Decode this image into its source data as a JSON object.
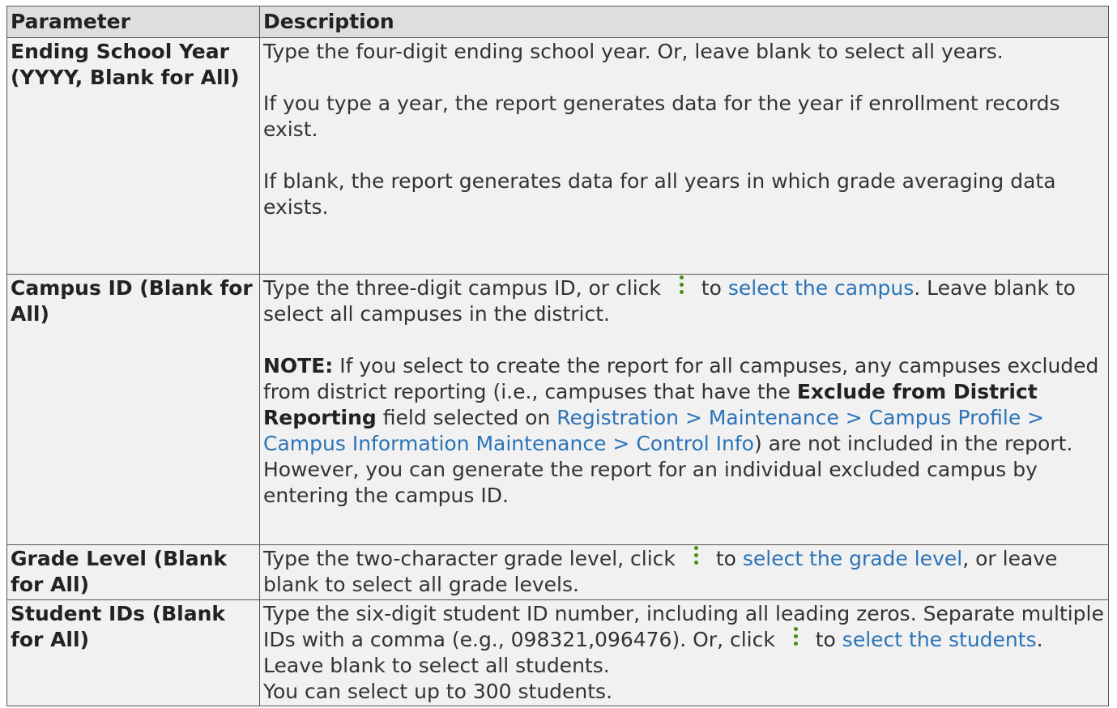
{
  "table": {
    "headers": {
      "parameter": "Parameter",
      "description": "Description"
    },
    "rows": [
      {
        "param": "Ending School Year (YYYY, Blank for All)",
        "p1": "Type the four-digit ending school year. Or, leave blank to select all years.",
        "p2": "If you type a year, the report generates data for the year if enrollment records exist.",
        "p3": "If blank, the report generates data for all years in which grade averaging data exists."
      },
      {
        "param": "Campus ID (Blank for All)",
        "text1": "Type the three-digit campus ID, or click",
        "text2": "to",
        "link1": "select the campus",
        "text3": ". Leave blank to select all campuses in the district.",
        "note_label": "NOTE:",
        "note_text1": " If you select to create the report for all campuses, any campuses excluded from district reporting (i.e., campuses that have the ",
        "note_bold": "Exclude from District Reporting",
        "note_text2": " field selected on ",
        "note_link": "Registration > Maintenance > Campus Profile > Campus Information Maintenance > Control Info",
        "note_text3": ") are not included in the report. However, you can generate the report for an individual excluded campus by entering the campus ID."
      },
      {
        "param": "Grade Level (Blank for All)",
        "text1": "Type the two-character grade level, click",
        "text2": "to",
        "link1": "select the grade level",
        "text3": ", or leave blank to select all grade levels."
      },
      {
        "param": "Student IDs (Blank for All)",
        "text1": "Type the six-digit student ID number, including all leading zeros. Separate multiple IDs with a comma (e.g., 098321,096476). Or, click",
        "text2": "to",
        "link1": "select the students",
        "text3": ". Leave blank to select all students.",
        "text4": "You can select up to 300 students."
      }
    ]
  },
  "icons": {
    "lookup": "kebab-vertical-dots-icon",
    "lookup_color": "#4d8a1e"
  },
  "colors": {
    "link": "#2b73b7",
    "header_bg": "#dedede",
    "cell_bg": "#f1f1f1"
  }
}
